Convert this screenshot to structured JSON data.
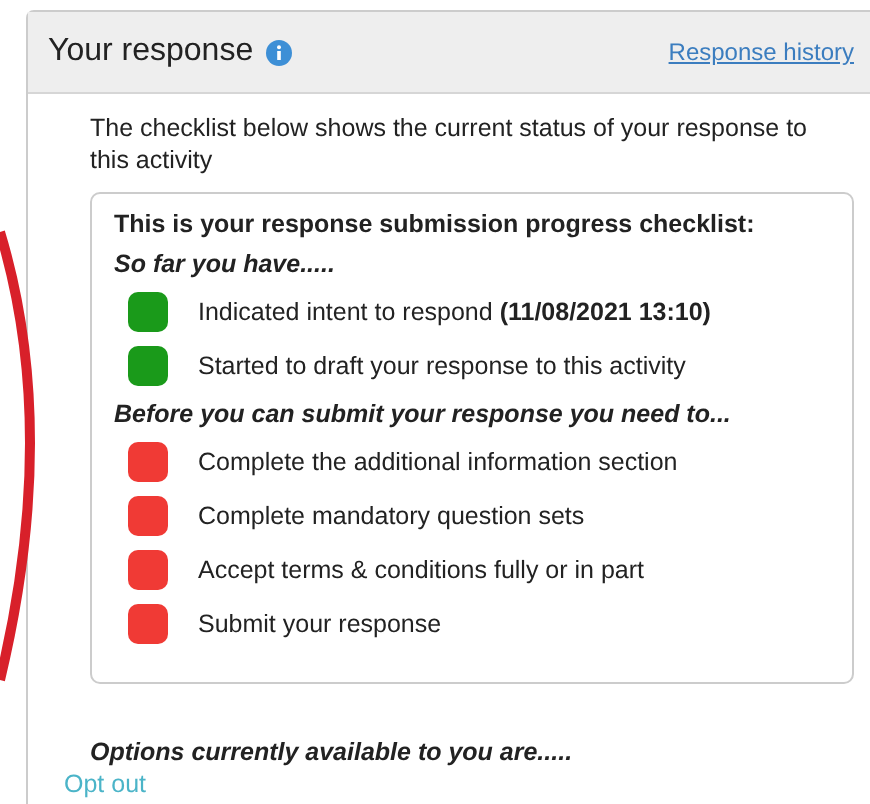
{
  "panel": {
    "title": "Your response",
    "history_link": "Response history"
  },
  "intro": "The checklist below shows the current status of your response to this activity",
  "checklist": {
    "title": "This is your response submission progress checklist:",
    "groups": [
      {
        "heading": "So far you have.....",
        "items": [
          {
            "text": "Indicated intent to respond **(11/08/2021 13:10)**",
            "done": true
          },
          {
            "text": "Started to draft your response to this activity",
            "done": true
          }
        ]
      },
      {
        "heading": "Before you can submit your response you need to...",
        "items": [
          {
            "text": "Complete the additional information section",
            "done": false
          },
          {
            "text": "Complete mandatory question sets",
            "done": false
          },
          {
            "text": "Accept terms & conditions fully or in part",
            "done": false
          },
          {
            "text": "Submit your response",
            "done": false
          }
        ]
      }
    ]
  },
  "options": {
    "heading": "Options currently available to you are.....",
    "links": [
      "Opt out"
    ]
  }
}
